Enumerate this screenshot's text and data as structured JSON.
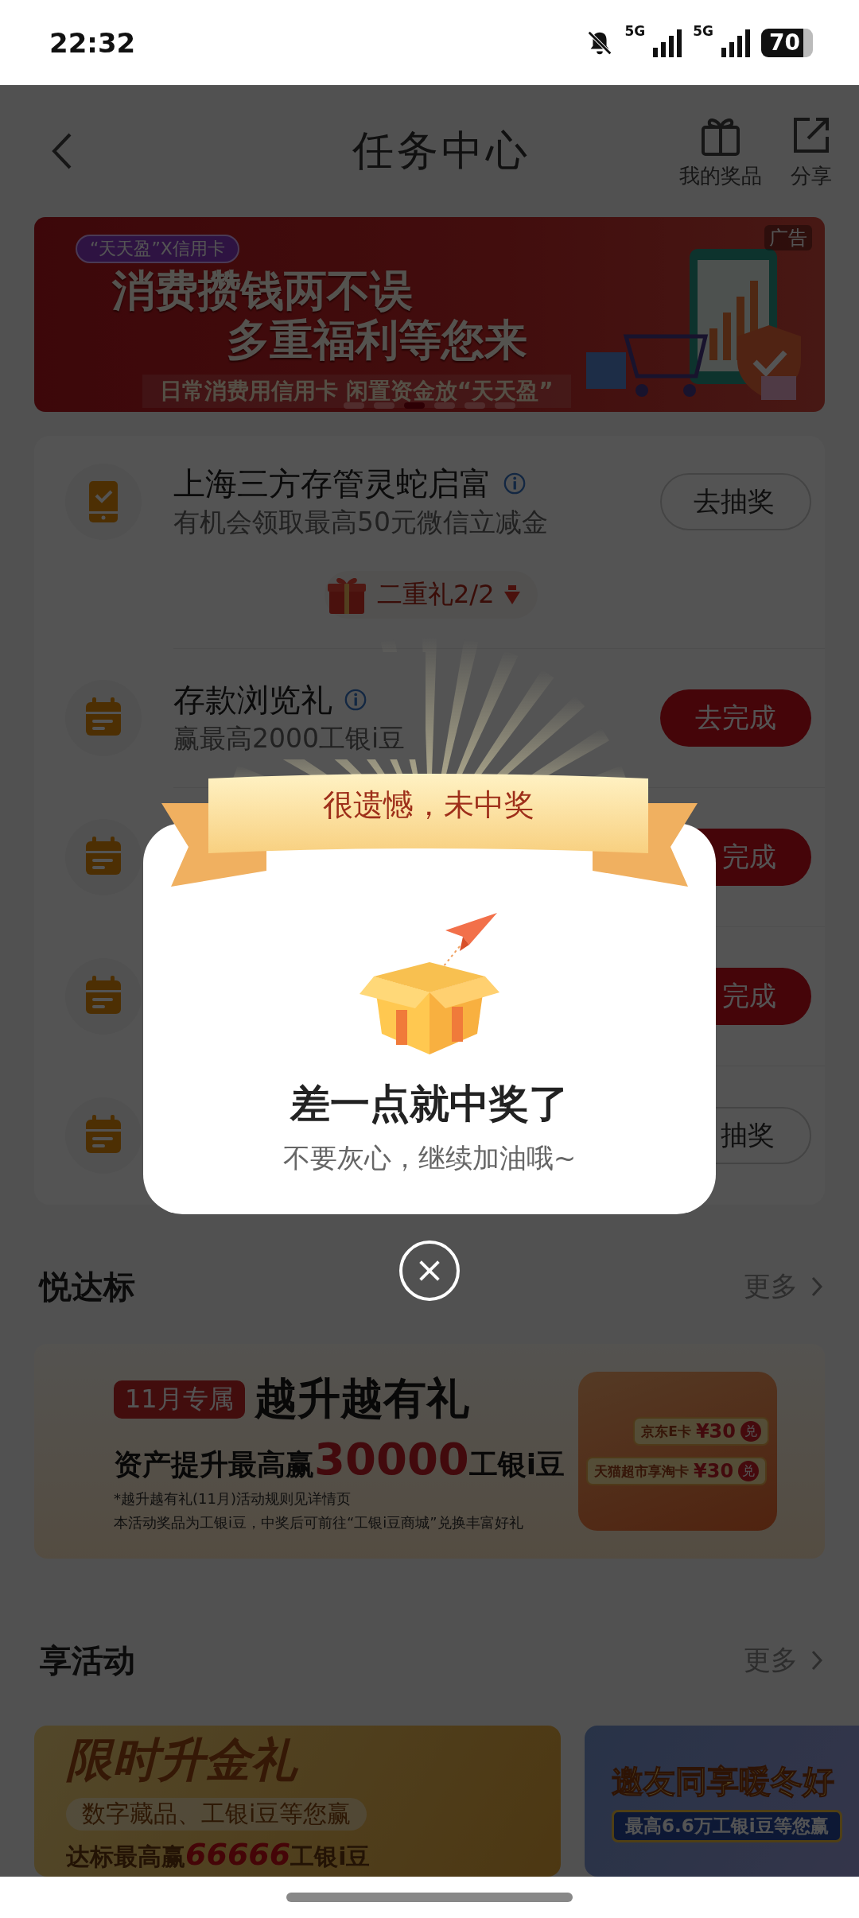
{
  "status_bar": {
    "time": "22:32",
    "networks": [
      "5G",
      "5G"
    ],
    "battery": "70"
  },
  "header": {
    "title": "任务中心",
    "actions": [
      {
        "kind": "gift",
        "label": "我的奖品"
      },
      {
        "kind": "share",
        "label": "分享"
      }
    ]
  },
  "top_banner": {
    "tag": "“天天盈”X信用卡",
    "headline": [
      "消费攒钱两不误",
      "多重福利等您来"
    ],
    "tagline": "日常消费用信用卡  闲置资金放“天天盈”",
    "ad_label": "广告",
    "dots": [
      {
        "selected": false
      },
      {
        "selected": false
      },
      {
        "selected": true
      },
      {
        "selected": false
      },
      {
        "selected": false
      },
      {
        "selected": false
      }
    ]
  },
  "tasks": [
    {
      "kind": "phone",
      "title": "上海三方存管灵蛇启富",
      "info": true,
      "subtitle": "有机会领取最高50元微信立减金",
      "reward_tag": "二重礼2/2",
      "button": {
        "label": "去抽奖",
        "kind": "outline"
      }
    },
    {
      "kind": "calendar",
      "title": "存款浏览礼",
      "info": true,
      "subtitle": "赢最高2000工银i豆",
      "button": {
        "label": "去完成",
        "kind": "filled"
      }
    },
    {
      "kind": "calendar",
      "button": {
        "label": "完成",
        "kind": "filled"
      }
    },
    {
      "kind": "calendar",
      "button": {
        "label": "完成",
        "kind": "filled"
      }
    },
    {
      "kind": "calendar",
      "button": {
        "label": "抽奖",
        "kind": "outline"
      }
    }
  ],
  "sections": [
    {
      "title": "悦达标",
      "more": "更多",
      "banners": [
        {
          "kind": "cream",
          "badge": "11月专属",
          "title": "越升越有礼",
          "line": "资产提升最高赢**30000**工银i豆",
          "notes": [
            "*越升越有礼(11月)活动规则见详情页",
            "本活动奖品为工银i豆，中奖后可前往“工银i豆商城”兑换丰富好礼"
          ],
          "cards": [
            {
              "name": "京东E卡",
              "amount": "¥30",
              "action": "兑"
            },
            {
              "name": "天猫超市享淘卡",
              "amount": "¥30",
              "action": "兑"
            }
          ]
        }
      ]
    },
    {
      "title": "享活动",
      "more": "更多",
      "banners": [
        {
          "kind": "gold",
          "title": "限时升金礼",
          "pill": "数字藏品、工银i豆等您赢",
          "line": "达标最高赢**66666**工银i豆"
        },
        {
          "kind": "blue",
          "title": "邀友同享暖冬好",
          "pill": "最高6.6万工银i豆等您赢"
        }
      ]
    }
  ],
  "dialog": {
    "ribbon": "很遗憾，未中奖",
    "title": "差一点就中奖了",
    "message": "不要灰心，继续加油哦~"
  }
}
